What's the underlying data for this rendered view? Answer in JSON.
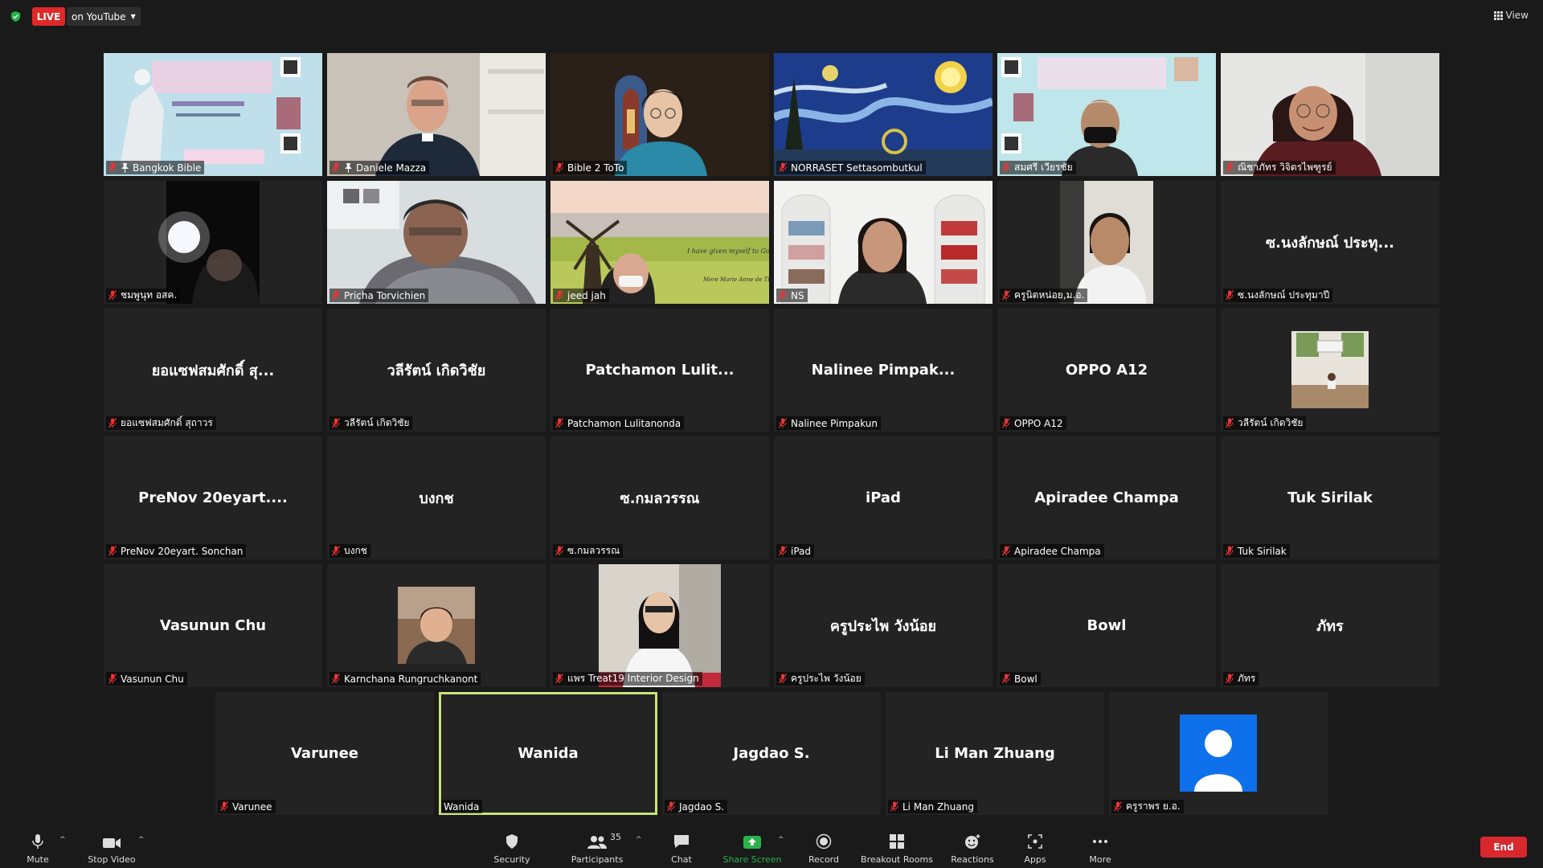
{
  "topbar": {
    "live_label": "LIVE",
    "live_target": "on YouTube",
    "view_label": "View"
  },
  "tiles": [
    {
      "label": "Bangkok Bible",
      "center": "",
      "video": "poster-bible",
      "pinned": true
    },
    {
      "label": "Daniele Mazza",
      "center": "",
      "video": "priest",
      "pinned": true
    },
    {
      "label": "Bible 2 ToTo",
      "center": "",
      "video": "church-girl"
    },
    {
      "label": "NORRASET Settasombutkul",
      "center": "",
      "video": "starry-night"
    },
    {
      "label": "สมศรี เวียรชัย",
      "center": "",
      "video": "poster-mask"
    },
    {
      "label": "ณิชาภัทร วิจิตรไพฑูรย์",
      "center": "",
      "video": "woman-kitchen"
    },
    {
      "label": "ชมพูนุท อสค.",
      "center": "",
      "video": "dark-phone"
    },
    {
      "label": "Pricha Torvichien",
      "center": "",
      "video": "man-room"
    },
    {
      "label": "jeed jah",
      "center": "",
      "video": "windmill"
    },
    {
      "label": "NS",
      "center": "",
      "video": "shelves"
    },
    {
      "label": "ครูนิตหน่อย,ม.อ.",
      "center": "",
      "video": "woman-phone"
    },
    {
      "label": "ซ.นงลักษณ์ ประทุมาปี",
      "center": "ซ.นงลักษณ์ ประทุ...",
      "video": ""
    },
    {
      "label": "ยอแซฟสมศักดิ์ สุถาวร",
      "center": "ยอแซฟสมศักดิ์ สุ...",
      "video": ""
    },
    {
      "label": "วลีรัตน์ เกิดวิชัย",
      "center": "วลีรัตน์ เกิดวิชัย",
      "video": ""
    },
    {
      "label": "Patchamon Lulitanonda",
      "center": "Patchamon Lulit...",
      "video": ""
    },
    {
      "label": "Nalinee  Pimpakun",
      "center": "Nalinee  Pimpak...",
      "video": ""
    },
    {
      "label": "OPPO A12",
      "center": "OPPO A12",
      "video": ""
    },
    {
      "label": "วลีรัตน์ เกิดวิชัย",
      "center": "",
      "video": "profile-photo"
    },
    {
      "label": "PreNov 20eyart.  Sonchan",
      "center": "PreNov 20eyart....",
      "video": ""
    },
    {
      "label": "บงกช",
      "center": "บงกช",
      "video": ""
    },
    {
      "label": "ซ.กมลวรรณ",
      "center": "ซ.กมลวรรณ",
      "video": ""
    },
    {
      "label": "iPad",
      "center": "iPad",
      "video": ""
    },
    {
      "label": "Apiradee Champa",
      "center": "Apiradee Champa",
      "video": ""
    },
    {
      "label": "Tuk Sirilak",
      "center": "Tuk Sirilak",
      "video": ""
    },
    {
      "label": "Vasunun Chu",
      "center": "Vasunun Chu",
      "video": ""
    },
    {
      "label": "Karnchana Rungruchkanont",
      "center": "",
      "video": "profile-woman"
    },
    {
      "label": "แพร Treat19 Interior Design",
      "center": "",
      "video": "profile-long"
    },
    {
      "label": "ครูประไพ  วังน้อย",
      "center": "ครูประไพ  วังน้อย",
      "video": ""
    },
    {
      "label": "Bowl",
      "center": "Bowl",
      "video": ""
    },
    {
      "label": "ภัทร",
      "center": "ภัทร",
      "video": ""
    },
    {
      "label": "Varunee",
      "center": "Varunee",
      "video": ""
    },
    {
      "label": "Wanida",
      "center": "Wanida",
      "video": "",
      "active": true
    },
    {
      "label": "Jagdao S.",
      "center": "Jagdao S.",
      "video": ""
    },
    {
      "label": "Li Man Zhuang",
      "center": "Li Man Zhuang",
      "video": ""
    },
    {
      "label": "ครูราพร ย.อ.",
      "center": "",
      "video": "default-avatar"
    }
  ],
  "toolbar": {
    "mute": "Mute",
    "stop_video": "Stop Video",
    "security": "Security",
    "participants": "Participants",
    "participant_count": "35",
    "chat": "Chat",
    "share_screen": "Share Screen",
    "record": "Record",
    "breakout": "Breakout Rooms",
    "reactions": "Reactions",
    "apps": "Apps",
    "more": "More",
    "end": "End"
  },
  "colors": {
    "live": "#e02828",
    "end": "#d9272e",
    "active_speaker": "#c8e37b",
    "share_green": "#2bb34b",
    "tile_bg": "#232323"
  }
}
